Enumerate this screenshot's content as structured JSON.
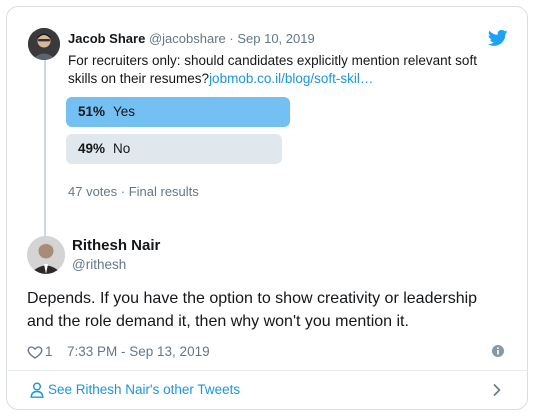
{
  "quoted_tweet": {
    "author_name": "Jacob Share",
    "author_handle": "@jacobshare",
    "separator": "·",
    "date": "Sep 10, 2019",
    "text": "For recruiters only: should candidates explicitly mention relevant soft skills on their resumes?",
    "link": "jobmob.co.il/blog/soft-skil…",
    "icon": "twitter-bird-icon",
    "poll": {
      "options": [
        {
          "percent": "51%",
          "label": "Yes",
          "share": 0.51
        },
        {
          "percent": "49%",
          "label": "No",
          "share": 0.49
        }
      ],
      "meta": "47 votes · Final results"
    }
  },
  "tweet": {
    "author_name": "Rithesh Nair",
    "author_handle": "@rithesh",
    "text": "Depends. If you have the option to show creativity or leadership and the role demand it, then why won't you mention it.",
    "like_count": "1",
    "timestamp": "7:33 PM - Sep 13, 2019"
  },
  "footer": {
    "see_more_label": "See Rithesh Nair's other Tweets"
  },
  "colors": {
    "accent": "#1b95e0",
    "poll_winner": "#74c0f3",
    "poll_other": "#e1e8ed",
    "muted_text": "#657786"
  }
}
